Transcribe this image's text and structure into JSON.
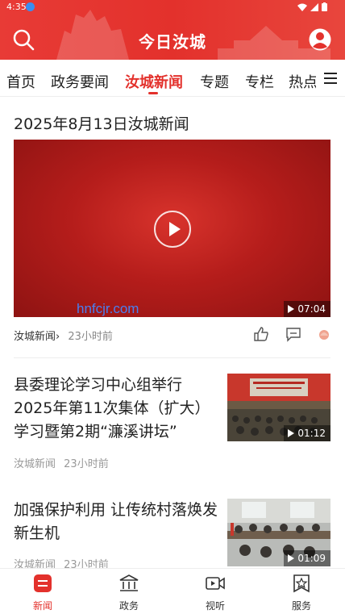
{
  "status": {
    "time": "4:35"
  },
  "header": {
    "title": "今日汝城"
  },
  "tabs": [
    {
      "label": "首页"
    },
    {
      "label": "政务要闻"
    },
    {
      "label": "汝城新闻"
    },
    {
      "label": "专题"
    },
    {
      "label": "专栏"
    },
    {
      "label": "热点"
    }
  ],
  "feed": {
    "video_item": {
      "title": "2025年8月13日汝城新闻",
      "watermark": "hnfcjr.com",
      "duration": "07:04",
      "source": "汝城新闻",
      "time": "23小时前"
    },
    "news": [
      {
        "title": "县委理论学习中心组举行2025年第11次集体（扩大）学习暨第2期“濂溪讲坛”",
        "duration": "01:12",
        "source": "汝城新闻",
        "time": "23小时前"
      },
      {
        "title": "加强保护利用 让传统村落焕发新生机",
        "duration": "01:09",
        "source": "汝城新闻",
        "time": "23小时前"
      }
    ]
  },
  "bottom_nav": [
    {
      "label": "新闻",
      "icon": "news-icon"
    },
    {
      "label": "政务",
      "icon": "government-building-icon"
    },
    {
      "label": "视听",
      "icon": "video-camera-icon"
    },
    {
      "label": "服务",
      "icon": "service-star-icon"
    }
  ],
  "colors": {
    "brand_red": "#e3312c",
    "watermark_blue": "#4a7ff0"
  }
}
